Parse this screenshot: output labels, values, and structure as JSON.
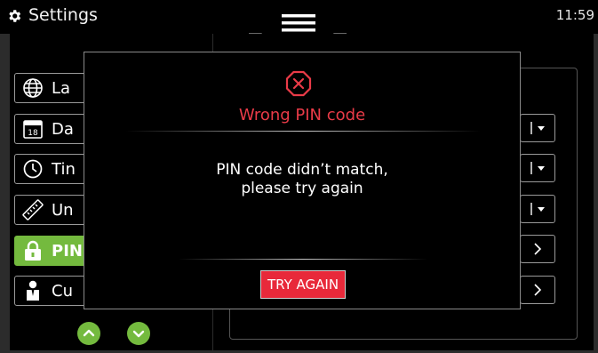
{
  "header": {
    "title": "Settings",
    "time": "11:59",
    "settings_icon": "gear-icon",
    "menu_icon": "hamburger-menu-icon"
  },
  "sidebar": {
    "items": [
      {
        "label": "La",
        "icon": "globe-icon"
      },
      {
        "label": "Da",
        "icon": "calendar-icon",
        "icon_text": "18"
      },
      {
        "label": "Tin",
        "icon": "clock-icon"
      },
      {
        "label": "Un",
        "icon": "ruler-icon"
      },
      {
        "label": "PIN",
        "icon": "lock-icon",
        "active": true
      },
      {
        "label": "Cu",
        "icon": "person-icon"
      }
    ],
    "scroll_up_icon": "chevron-up-icon",
    "scroll_down_icon": "chevron-down-icon"
  },
  "right_rows": [
    {
      "icon": "dropdown-icon"
    },
    {
      "icon": "dropdown-icon"
    },
    {
      "icon": "dropdown-icon"
    },
    {
      "icon": "chevron-right-icon"
    },
    {
      "icon": "chevron-right-icon"
    }
  ],
  "dialog": {
    "icon": "error-octagon-icon",
    "title": "Wrong PIN code",
    "message_line1": "PIN code didn’t match,",
    "message_line2": "please try again",
    "button_label": "TRY AGAIN"
  },
  "colors": {
    "accent_green": "#74ba3e",
    "error_red": "#ea3b48",
    "button_red": "#e8293a"
  }
}
